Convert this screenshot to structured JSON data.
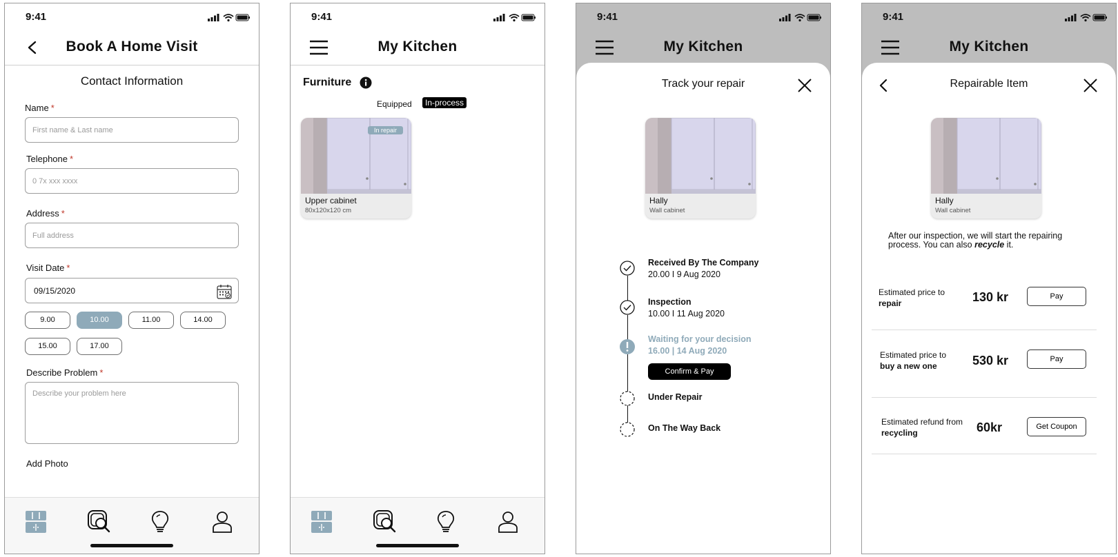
{
  "status": {
    "time": "9:41"
  },
  "colors": {
    "accent": "#8faab9",
    "dim": "#bdbdbd"
  },
  "screen1": {
    "title": "Book A Home Visit",
    "section": "Contact Information",
    "name": {
      "label": "Name",
      "placeholder": "First name & Last name"
    },
    "telephone": {
      "label": "Telephone",
      "placeholder": "0 7x xxx xxxx"
    },
    "address": {
      "label": "Address",
      "placeholder": "Full address"
    },
    "visit_date": {
      "label": "Visit Date",
      "value": "09/15/2020"
    },
    "required_mark": "*",
    "time_slots": [
      "9.00",
      "10.00",
      "11.00",
      "14.00",
      "15.00",
      "17.00"
    ],
    "selected_slot": "10.00",
    "problem": {
      "label": "Describe Problem",
      "placeholder": "Describe your problem here"
    },
    "add_photo": "Add Photo"
  },
  "screen2": {
    "title": "My Kitchen",
    "section": "Furniture",
    "segments": [
      "Equipped",
      "In-process"
    ],
    "active_segment": "In-process",
    "item": {
      "badge": "In repair",
      "name": "Upper cabinet",
      "size": "80x120x120 cm"
    }
  },
  "screen3": {
    "title": "My Kitchen",
    "sheet_title": "Track your repair",
    "item": {
      "name": "Hally",
      "type": "Wall cabinet"
    },
    "steps": [
      {
        "title": "Received By The Company",
        "date": "20.00 I 9 Aug 2020",
        "state": "done"
      },
      {
        "title": "Inspection",
        "date": "10.00 I 11 Aug 2020",
        "state": "done"
      },
      {
        "title": "Waiting for your decision",
        "date": "16.00 | 14 Aug 2020",
        "state": "current"
      },
      {
        "title": "Under Repair",
        "date": "",
        "state": "pending"
      },
      {
        "title": "On The Way Back",
        "date": "",
        "state": "pending"
      }
    ],
    "confirm_label": "Confirm & Pay"
  },
  "screen4": {
    "title": "My Kitchen",
    "sheet_title": "Repairable Item",
    "item": {
      "name": "Hally",
      "type": "Wall cabinet"
    },
    "intro_pre": "After our inspection, we will start the repairing process. You can also ",
    "intro_em": "recycle",
    "intro_post": " it.",
    "options": [
      {
        "label_line1": "Estimated price to",
        "label_line2": "repair",
        "amount": "130 kr",
        "button": "Pay"
      },
      {
        "label_line1": "Estimated price to",
        "label_line2": "buy a new one",
        "amount": "530 kr",
        "button": "Pay"
      },
      {
        "label_line1": "Estimated refund from",
        "label_line2": "recycling",
        "amount": "60kr",
        "button": "Get Coupon"
      }
    ]
  },
  "tabbar": {
    "icons": [
      "kitchen-icon",
      "scan-search-icon",
      "lightbulb-icon",
      "profile-icon"
    ],
    "active": "kitchen-icon"
  }
}
